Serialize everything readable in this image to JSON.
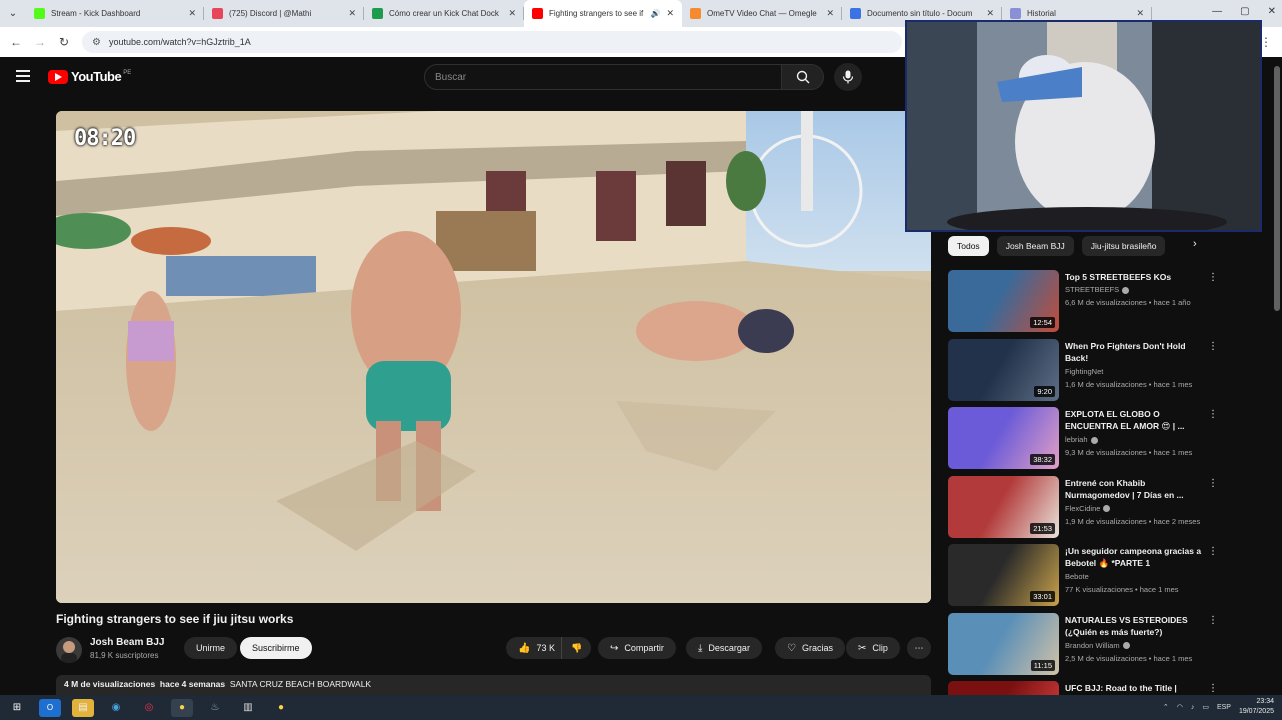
{
  "browser": {
    "tabs": [
      {
        "title": "Stream - Kick Dashboard",
        "favicon_color": "#53fc18",
        "active": false
      },
      {
        "title": "(725) Discord | @Mathi",
        "favicon_color": "#e8455a",
        "active": false
      },
      {
        "title": "Cómo crear un Kick Chat Dock",
        "favicon_color": "#1e9b4c",
        "active": false
      },
      {
        "title": "Fighting strangers to see if",
        "favicon_color": "#ff0000",
        "active": true
      },
      {
        "title": "OmeTV Video Chat — Omegle",
        "favicon_color": "#f58a2e",
        "active": false
      },
      {
        "title": "Documento sin título - Docum",
        "favicon_color": "#3b73e6",
        "active": false
      },
      {
        "title": "Historial",
        "favicon_color": "#8a8fd6",
        "active": false
      }
    ],
    "url": "youtube.com/watch?v=hGJztrib_1A"
  },
  "youtube": {
    "logo_text": "YouTube",
    "country_code": "PE",
    "search_placeholder": "Buscar"
  },
  "video": {
    "timer_overlay": "08:20",
    "title": "Fighting strangers to see if jiu jitsu works",
    "channel_name": "Josh Beam BJJ",
    "subscribers": "81,9 K suscriptores",
    "join_label": "Unirme",
    "subscribe_label": "Suscribirme",
    "like_count": "73 K",
    "share_label": "Compartir",
    "download_label": "Descargar",
    "thanks_label": "Gracias",
    "clip_label": "Clip",
    "description_views": "4 M de visualizaciones",
    "description_date": "hace 4 semanas",
    "description_location": "SANTA CRUZ BEACH BOARDWALK"
  },
  "chips": [
    {
      "label": "Todos",
      "active": true
    },
    {
      "label": "Josh Beam BJJ",
      "active": false
    },
    {
      "label": "Jiu-jitsu brasileño",
      "active": false
    }
  ],
  "recommendations": [
    {
      "title": "Top 5 STREETBEEFS KOs",
      "channel": "STREETBEEFS",
      "verified": true,
      "meta": "6,6 M de visualizaciones • hace 1 año",
      "duration": "12:54",
      "thumb": [
        "#3a6a9a",
        "#c24d3a"
      ]
    },
    {
      "title": "When Pro Fighters Don't Hold Back!",
      "channel": "FightingNet",
      "verified": false,
      "meta": "1,6 M de visualizaciones • hace 1 mes",
      "duration": "9:20",
      "thumb": [
        "#22324a",
        "#5d6f86"
      ]
    },
    {
      "title": "EXPLOTA EL GLOBO O ENCUENTRA EL AMOR 😍 | ...",
      "channel": "lebriah",
      "verified": true,
      "meta": "9,3 M de visualizaciones • hace 1 mes",
      "duration": "38:32",
      "thumb": [
        "#6b5bd8",
        "#e2a0c6"
      ]
    },
    {
      "title": "Entrené con Khabib Nurmagomedov | 7 Días en ...",
      "channel": "FlexCidine",
      "verified": true,
      "meta": "1,9 M de visualizaciones • hace 2 meses",
      "duration": "21:53",
      "thumb": [
        "#b23a3a",
        "#e9e4dc"
      ]
    },
    {
      "title": "¡Un seguidor campeona gracias a Bebotel 🔥 *PARTE 1",
      "channel": "Bebote",
      "verified": false,
      "meta": "77 K visualizaciones • hace 1 mes",
      "duration": "33:01",
      "thumb": [
        "#2a2a2a",
        "#c9a24a"
      ]
    },
    {
      "title": "NATURALES VS ESTEROIDES (¿Quién es más fuerte?)",
      "channel": "Brandon William",
      "verified": true,
      "meta": "2,5 M de visualizaciones • hace 1 mes",
      "duration": "11:15",
      "thumb": [
        "#5a8fb8",
        "#d1c2a8"
      ]
    },
    {
      "title": "UFC BJJ: Road to the Title |",
      "channel": "",
      "verified": false,
      "meta": "",
      "duration": "",
      "thumb": [
        "#7a1010",
        "#d44"
      ]
    }
  ],
  "taskbar": {
    "language": "ESP",
    "time": "23:34",
    "date": "19/07/2025"
  }
}
